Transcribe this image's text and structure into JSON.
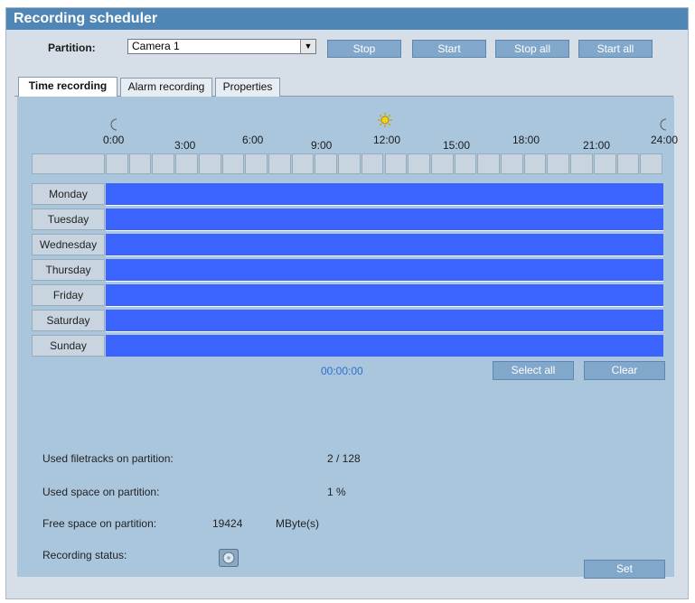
{
  "title": "Recording scheduler",
  "partition": {
    "label": "Partition:",
    "value": "Camera 1"
  },
  "buttons": {
    "stop": "Stop",
    "start": "Start",
    "stop_all": "Stop all",
    "start_all": "Start all",
    "select_all": "Select all",
    "clear": "Clear",
    "set": "Set"
  },
  "tabs": [
    "Time recording",
    "Alarm recording",
    "Properties"
  ],
  "hours": [
    "0:00",
    "3:00",
    "6:00",
    "9:00",
    "12:00",
    "15:00",
    "18:00",
    "21:00",
    "24:00"
  ],
  "days": [
    "Monday",
    "Tuesday",
    "Wednesday",
    "Thursday",
    "Friday",
    "Saturday",
    "Sunday"
  ],
  "timestamp": "00:00:00",
  "info": {
    "filetracks_label": "Used filetracks on partition:",
    "filetracks_value": "2 / 128",
    "space_label": "Used space on partition:",
    "space_value": "1 %",
    "free_label": "Free space on partition:",
    "free_value": "19424",
    "free_unit": "MByte(s)",
    "status_label": "Recording status:"
  },
  "icons": {
    "moon": "moon-icon",
    "sun": "sun-icon",
    "status": "disk-status-icon"
  },
  "colors": {
    "titlebar": "#4f86b6",
    "schedule": "#3b63fe",
    "panel": "#aac6dd",
    "button": "#81a7ca"
  }
}
